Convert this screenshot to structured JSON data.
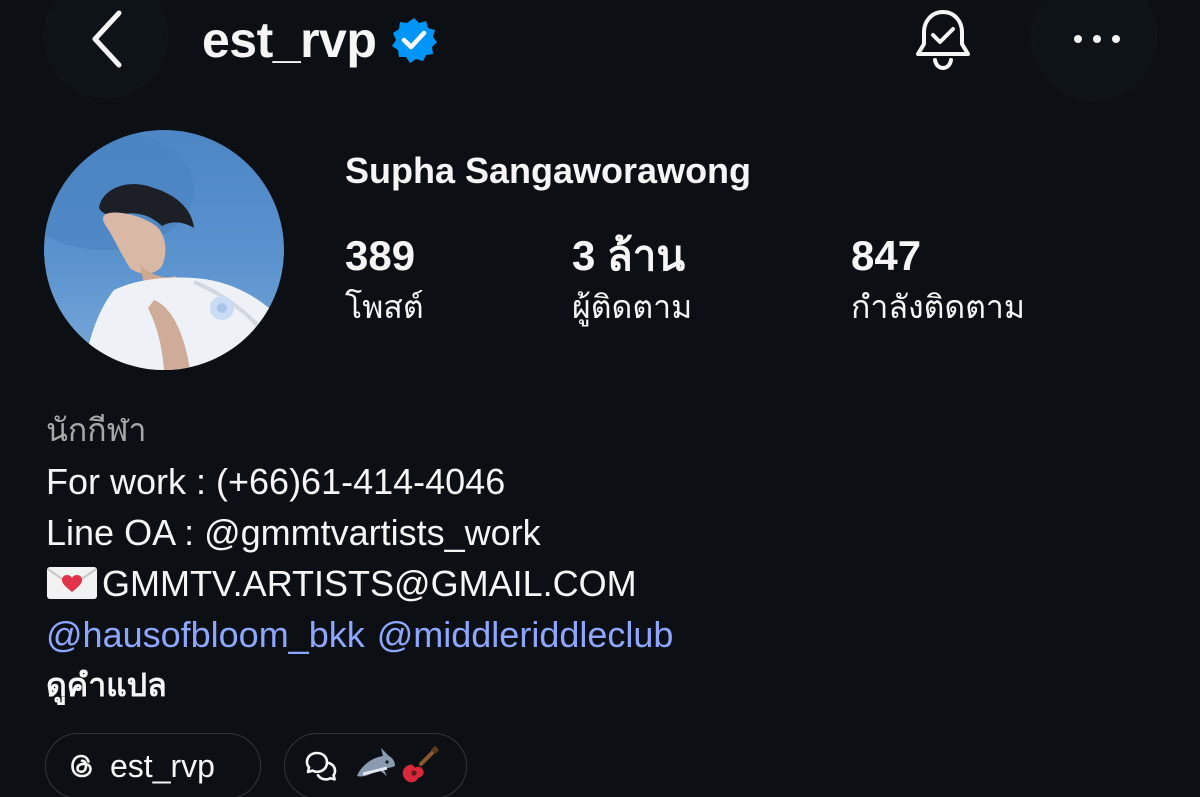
{
  "header": {
    "username": "est_rvp",
    "verified": true,
    "icons": {
      "back": "chevron-left-icon",
      "verified": "verified-badge-icon",
      "notifications": "bell-check-icon",
      "more": "more-horizontal-icon"
    }
  },
  "profile": {
    "full_name": "Supha Sangaworawong",
    "stats": {
      "posts": {
        "value": "389",
        "label": "โพสต์"
      },
      "followers": {
        "value": "3 ล้าน",
        "label": "ผู้ติดตาม"
      },
      "following": {
        "value": "847",
        "label": "กำลังติดตาม"
      }
    }
  },
  "bio": {
    "category": "นักกีฬา",
    "work_line": "For work : (+66)61-414-4046",
    "line_oa": "Line OA : @gmmtvartists_work",
    "email": "GMMTV.ARTISTS@GMAIL.COM",
    "mentions": [
      "@hausofbloom_bkk",
      "@middleriddleclub"
    ],
    "see_translation": "ดูคำแปล"
  },
  "chips": {
    "threads": {
      "label": "est_rvp",
      "icon": "threads-icon"
    },
    "note": {
      "icon": "chat-bubbles-icon",
      "emojis": [
        "shark-emoji",
        "guitar-emoji"
      ]
    }
  },
  "colors": {
    "background": "#0c1014",
    "text": "#f5f5f5",
    "secondary_text": "#a8a8a8",
    "link": "#8fa6ff",
    "verified": "#0095f6"
  }
}
